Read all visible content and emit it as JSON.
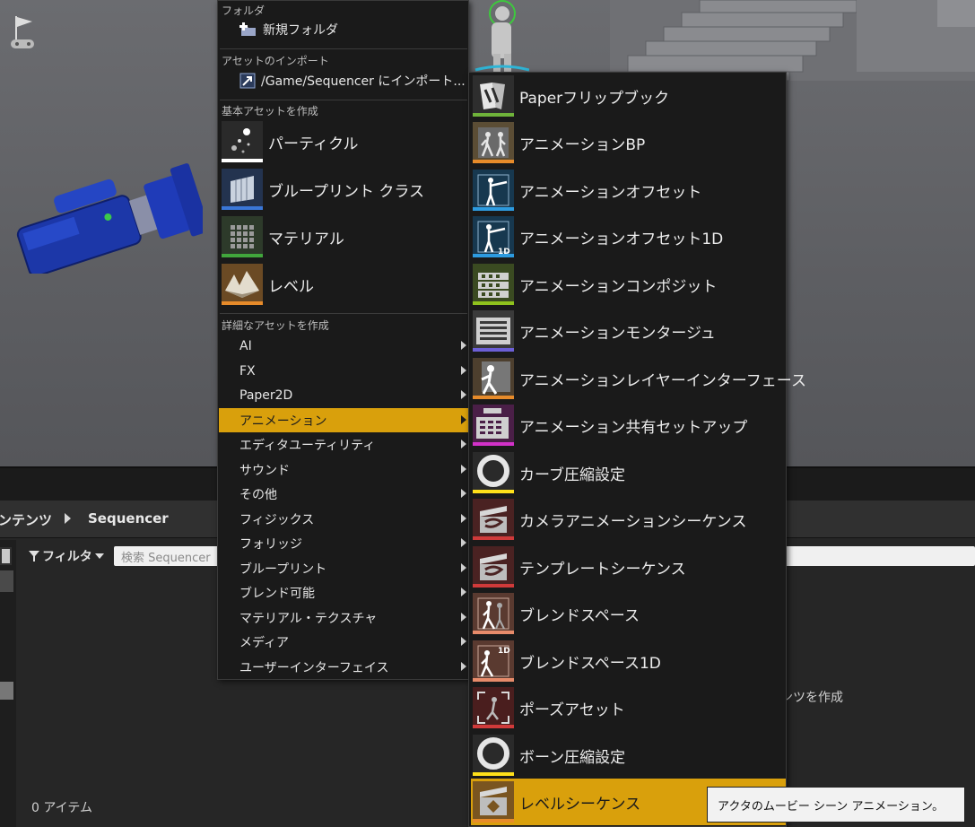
{
  "browser": {
    "breadcrumb": [
      "ンテンツ",
      "Sequencer"
    ],
    "filter_label": "フィルタ",
    "search_placeholder": "検索 Sequencer",
    "items_count": "0 アイテム",
    "create_hint": "ンツを作成"
  },
  "menu": {
    "folder_section": "フォルダ",
    "new_folder": "新規フォルダ",
    "import_section": "アセットのインポート",
    "import_item": "/Game/Sequencer にインポート...",
    "basic_section": "基本アセットを作成",
    "basic_items": [
      {
        "label": "パーティクル",
        "icon": "particle-icon",
        "bar": "#ffffff"
      },
      {
        "label": "ブループリント クラス",
        "icon": "blueprint-class-icon",
        "bar": "#3a77d8"
      },
      {
        "label": "マテリアル",
        "icon": "material-icon",
        "bar": "#41a63c"
      },
      {
        "label": "レベル",
        "icon": "level-icon",
        "bar": "#e78b2a"
      }
    ],
    "advanced_section": "詳細なアセットを作成",
    "categories": [
      "AI",
      "FX",
      "Paper2D",
      "アニメーション",
      "エディタユーティリティ",
      "サウンド",
      "その他",
      "フィジックス",
      "フォリッジ",
      "ブループリント",
      "ブレンド可能",
      "マテリアル・テクスチャ",
      "メディア",
      "ユーザーインターフェイス"
    ],
    "active_category": "アニメーション"
  },
  "submenu": {
    "items": [
      {
        "label": "Paperフリップブック",
        "icon": "paper-flipbook-icon",
        "bar": "#6fb33a",
        "bg": "#2e2e2e"
      },
      {
        "label": "アニメーションBP",
        "icon": "animation-blueprint-icon",
        "bar": "#e78b2a",
        "bg": "#5b4d35"
      },
      {
        "label": "アニメーションオフセット",
        "icon": "aim-offset-icon",
        "bar": "#2d9be0",
        "bg": "#17384f"
      },
      {
        "label": "アニメーションオフセット1D",
        "icon": "aim-offset-1d-icon",
        "bar": "#2d9be0",
        "bg": "#17384f"
      },
      {
        "label": "アニメーションコンポジット",
        "icon": "animation-composite-icon",
        "bar": "#8fc21d",
        "bg": "#3a4a21"
      },
      {
        "label": "アニメーションモンタージュ",
        "icon": "animation-montage-icon",
        "bar": "#6c5fd6",
        "bg": "#3a3a3a"
      },
      {
        "label": "アニメーションレイヤーインターフェース",
        "icon": "animation-layer-interface-icon",
        "bar": "#e78b2a",
        "bg": "#4d3f2e"
      },
      {
        "label": "アニメーション共有セットアップ",
        "icon": "animation-sharing-setup-icon",
        "bar": "#d331c9",
        "bg": "#4a1f47"
      },
      {
        "label": "カーブ圧縮設定",
        "icon": "curve-compression-icon",
        "bar": "#ffe01a",
        "bg": "#2a2a2a"
      },
      {
        "label": "カメラアニメーションシーケンス",
        "icon": "camera-animation-sequence-icon",
        "bar": "#d03a3a",
        "bg": "#4a2222"
      },
      {
        "label": "テンプレートシーケンス",
        "icon": "template-sequence-icon",
        "bar": "#d03a3a",
        "bg": "#4a2222"
      },
      {
        "label": "ブレンドスペース",
        "icon": "blend-space-icon",
        "bar": "#e78b6a",
        "bg": "#5a3a30"
      },
      {
        "label": "ブレンドスペース1D",
        "icon": "blend-space-1d-icon",
        "bar": "#e78b6a",
        "bg": "#5a3a30"
      },
      {
        "label": "ポーズアセット",
        "icon": "pose-asset-icon",
        "bar": "#d03a3a",
        "bg": "#4a1e1e"
      },
      {
        "label": "ボーン圧縮設定",
        "icon": "bone-compression-icon",
        "bar": "#ffe01a",
        "bg": "#2a2a2a"
      },
      {
        "label": "レベルシーケンス",
        "icon": "level-sequence-icon",
        "bar": "#e78b2a",
        "bg": "#7a5520"
      }
    ],
    "active_index": 15
  },
  "tooltip": "アクタのムービー シーン アニメーション。"
}
